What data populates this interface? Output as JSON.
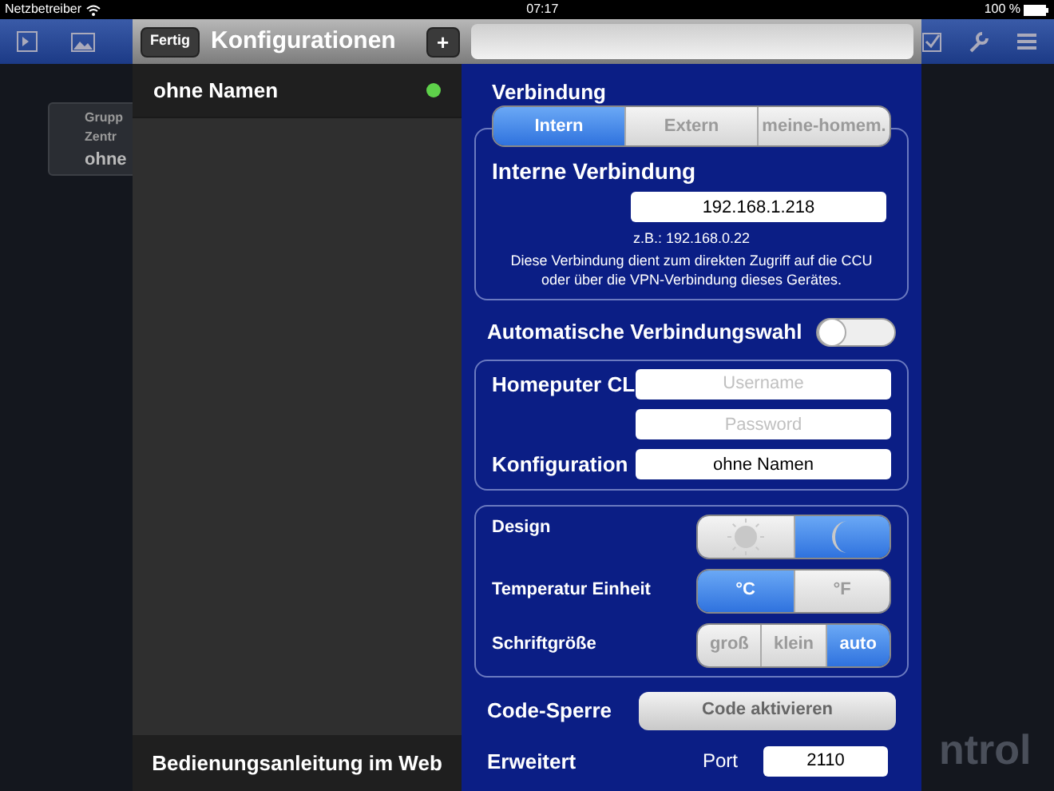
{
  "status_bar": {
    "carrier": "Netzbetreiber",
    "time": "07:17",
    "battery": "100 %"
  },
  "background": {
    "tile_lines": [
      "Grupp",
      "Zentr",
      "ohne"
    ],
    "corner_text": "ntrol"
  },
  "modal": {
    "done_button": "Fertig",
    "title": "Konfigurationen",
    "add_button": "+"
  },
  "configurations": [
    {
      "name": "ohne Namen",
      "selected": true,
      "color": "#5ed14a"
    }
  ],
  "manual_link": "Bedienungsanleitung im Web",
  "connection": {
    "heading": "Verbindung",
    "tabs": [
      {
        "label": "Intern",
        "selected": true
      },
      {
        "label": "Extern",
        "selected": false
      },
      {
        "label": "meine-homem.",
        "selected": false
      }
    ],
    "internal": {
      "heading": "Interne Verbindung",
      "value": "192.168.1.218",
      "example": "z.B.: 192.168.0.22",
      "description": "Diese Verbindung dient zum direkten Zugriff auf die CCU oder über die VPN-Verbindung dieses Gerätes."
    }
  },
  "auto_connection": {
    "label": "Automatische Verbindungswahl",
    "on": false
  },
  "account": {
    "label": "Homeputer CL",
    "username": {
      "placeholder": "Username"
    },
    "password": {
      "placeholder": "Password"
    },
    "config_label": "Konfiguration",
    "config_value": "ohne Namen"
  },
  "settings": [
    {
      "label": "Design",
      "options": [
        {
          "kind": "sun",
          "selected": false
        },
        {
          "kind": "moon",
          "selected": true
        }
      ]
    },
    {
      "label": "Temperatur Einheit",
      "options": [
        {
          "kind": "text",
          "label": "°C",
          "selected": true
        },
        {
          "kind": "text",
          "label": "°F",
          "selected": false
        }
      ]
    },
    {
      "label": "Schriftgröße",
      "options": [
        {
          "kind": "text",
          "label": "groß",
          "selected": false
        },
        {
          "kind": "text",
          "label": "klein",
          "selected": false
        },
        {
          "kind": "text",
          "label": "auto",
          "selected": true
        }
      ]
    }
  ],
  "code_lock": {
    "label": "Code-Sperre",
    "button": "Code aktivieren"
  },
  "advanced": {
    "label": "Erweitert",
    "port_label": "Port",
    "port_value": "2110"
  }
}
